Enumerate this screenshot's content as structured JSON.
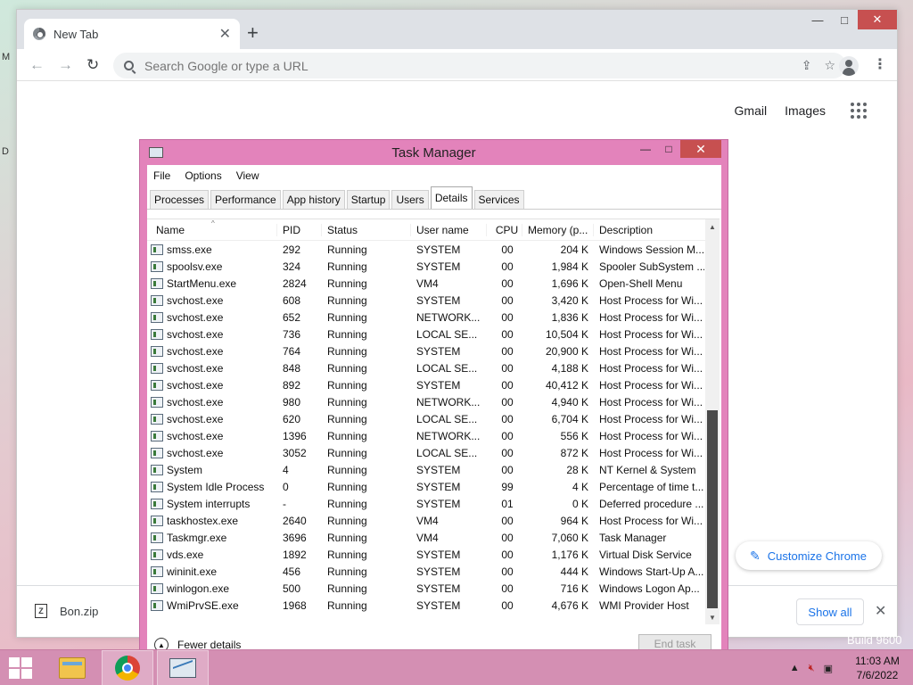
{
  "chrome": {
    "tab_title": "New Tab",
    "omnibox_placeholder": "Search Google or type a URL",
    "links": {
      "gmail": "Gmail",
      "images": "Images"
    },
    "customize_label": "Customize Chrome",
    "download": {
      "file": "Bon.zip",
      "show_all": "Show all"
    }
  },
  "taskmgr": {
    "title": "Task Manager",
    "menu": [
      "File",
      "Options",
      "View"
    ],
    "tabs": [
      "Processes",
      "Performance",
      "App history",
      "Startup",
      "Users",
      "Details",
      "Services"
    ],
    "active_tab": "Details",
    "columns": [
      "Name",
      "PID",
      "Status",
      "User name",
      "CPU",
      "Memory (p...",
      "Description"
    ],
    "rows": [
      [
        "smss.exe",
        "292",
        "Running",
        "SYSTEM",
        "00",
        "204 K",
        "Windows Session M..."
      ],
      [
        "spoolsv.exe",
        "324",
        "Running",
        "SYSTEM",
        "00",
        "1,984 K",
        "Spooler SubSystem ..."
      ],
      [
        "StartMenu.exe",
        "2824",
        "Running",
        "VM4",
        "00",
        "1,696 K",
        "Open-Shell Menu"
      ],
      [
        "svchost.exe",
        "608",
        "Running",
        "SYSTEM",
        "00",
        "3,420 K",
        "Host Process for Wi..."
      ],
      [
        "svchost.exe",
        "652",
        "Running",
        "NETWORK...",
        "00",
        "1,836 K",
        "Host Process for Wi..."
      ],
      [
        "svchost.exe",
        "736",
        "Running",
        "LOCAL SE...",
        "00",
        "10,504 K",
        "Host Process for Wi..."
      ],
      [
        "svchost.exe",
        "764",
        "Running",
        "SYSTEM",
        "00",
        "20,900 K",
        "Host Process for Wi..."
      ],
      [
        "svchost.exe",
        "848",
        "Running",
        "LOCAL SE...",
        "00",
        "4,188 K",
        "Host Process for Wi..."
      ],
      [
        "svchost.exe",
        "892",
        "Running",
        "SYSTEM",
        "00",
        "40,412 K",
        "Host Process for Wi..."
      ],
      [
        "svchost.exe",
        "980",
        "Running",
        "NETWORK...",
        "00",
        "4,940 K",
        "Host Process for Wi..."
      ],
      [
        "svchost.exe",
        "620",
        "Running",
        "LOCAL SE...",
        "00",
        "6,704 K",
        "Host Process for Wi..."
      ],
      [
        "svchost.exe",
        "1396",
        "Running",
        "NETWORK...",
        "00",
        "556 K",
        "Host Process for Wi..."
      ],
      [
        "svchost.exe",
        "3052",
        "Running",
        "LOCAL SE...",
        "00",
        "872 K",
        "Host Process for Wi..."
      ],
      [
        "System",
        "4",
        "Running",
        "SYSTEM",
        "00",
        "28 K",
        "NT Kernel & System"
      ],
      [
        "System Idle Process",
        "0",
        "Running",
        "SYSTEM",
        "99",
        "4 K",
        "Percentage of time t..."
      ],
      [
        "System interrupts",
        "-",
        "Running",
        "SYSTEM",
        "01",
        "0 K",
        "Deferred procedure ..."
      ],
      [
        "taskhostex.exe",
        "2640",
        "Running",
        "VM4",
        "00",
        "964 K",
        "Host Process for Wi..."
      ],
      [
        "Taskmgr.exe",
        "3696",
        "Running",
        "VM4",
        "00",
        "7,060 K",
        "Task Manager"
      ],
      [
        "vds.exe",
        "1892",
        "Running",
        "SYSTEM",
        "00",
        "1,176 K",
        "Virtual Disk Service"
      ],
      [
        "wininit.exe",
        "456",
        "Running",
        "SYSTEM",
        "00",
        "444 K",
        "Windows Start-Up A..."
      ],
      [
        "winlogon.exe",
        "500",
        "Running",
        "SYSTEM",
        "00",
        "716 K",
        "Windows Logon Ap..."
      ],
      [
        "WmiPrvSE.exe",
        "1968",
        "Running",
        "SYSTEM",
        "00",
        "4,676 K",
        "WMI Provider Host"
      ]
    ],
    "fewer_details": "Fewer details",
    "end_task": "End task"
  },
  "desktop": {
    "build_text": "Build 9600",
    "frag_m": "M",
    "frag_d": "D"
  },
  "taskbar": {
    "time": "11:03 AM",
    "date": "7/6/2022"
  },
  "colors": {
    "taskbar": "#d48fb3",
    "tm_frame": "#e383bb",
    "close_red": "#c75050",
    "link_blue": "#1a73e8"
  }
}
